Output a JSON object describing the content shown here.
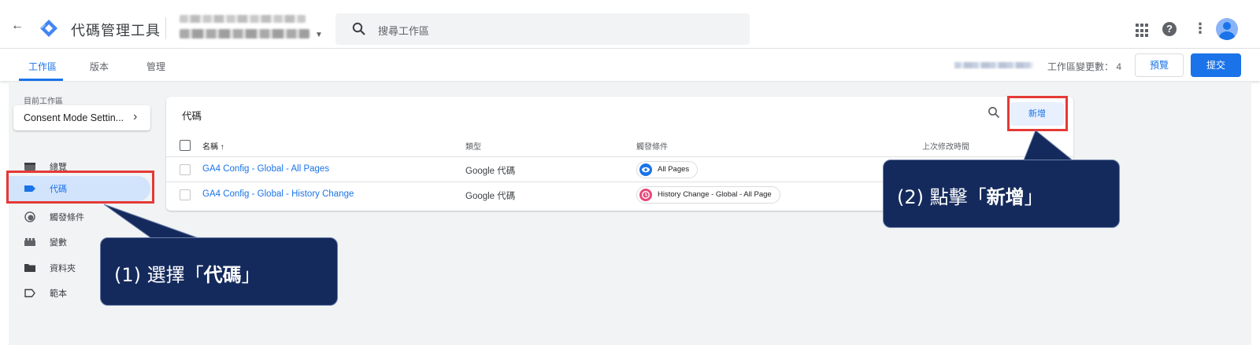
{
  "app": {
    "title": "代碼管理工具",
    "back_label": "←"
  },
  "search": {
    "placeholder": "搜尋工作區"
  },
  "tabs": [
    {
      "label": "工作區"
    },
    {
      "label": "版本"
    },
    {
      "label": "管理"
    }
  ],
  "workspace_bar": {
    "changes_label": "工作區變更數：",
    "changes_count": "4",
    "preview_label": "預覽",
    "submit_label": "提交"
  },
  "sidebar": {
    "workspace_label": "目前工作區",
    "workspace_name": "Consent Mode Settin...",
    "items": [
      {
        "label": "總覽",
        "icon": "overview-icon"
      },
      {
        "label": "代碼",
        "icon": "tag-icon"
      },
      {
        "label": "觸發條件",
        "icon": "trigger-icon"
      },
      {
        "label": "變數",
        "icon": "variable-icon"
      },
      {
        "label": "資料夾",
        "icon": "folder-icon"
      },
      {
        "label": "範本",
        "icon": "template-icon"
      }
    ]
  },
  "tags_card": {
    "title": "代碼",
    "new_label": "新增",
    "columns": [
      "名稱 ↑",
      "類型",
      "觸發條件",
      "上次修改時間"
    ],
    "rows": [
      {
        "name": "GA4 Config - Global - All Pages",
        "type": "Google 代碼",
        "trigger": "All Pages",
        "trigger_color": "#1a73e8"
      },
      {
        "name": "GA4 Config - Global - History Change",
        "type": "Google 代碼",
        "trigger": "History Change - Global - All Page",
        "trigger_color": "#e8497b"
      }
    ]
  },
  "callouts": {
    "one": {
      "prefix": "(1) 選擇「",
      "bold": "代碼",
      "suffix": "」"
    },
    "two": {
      "prefix": "(2) 點擊「",
      "bold": "新增",
      "suffix": "」"
    }
  },
  "colors": {
    "accent": "#1a73e8",
    "callout_bg": "#152a5c",
    "highlight": "#e53935"
  }
}
